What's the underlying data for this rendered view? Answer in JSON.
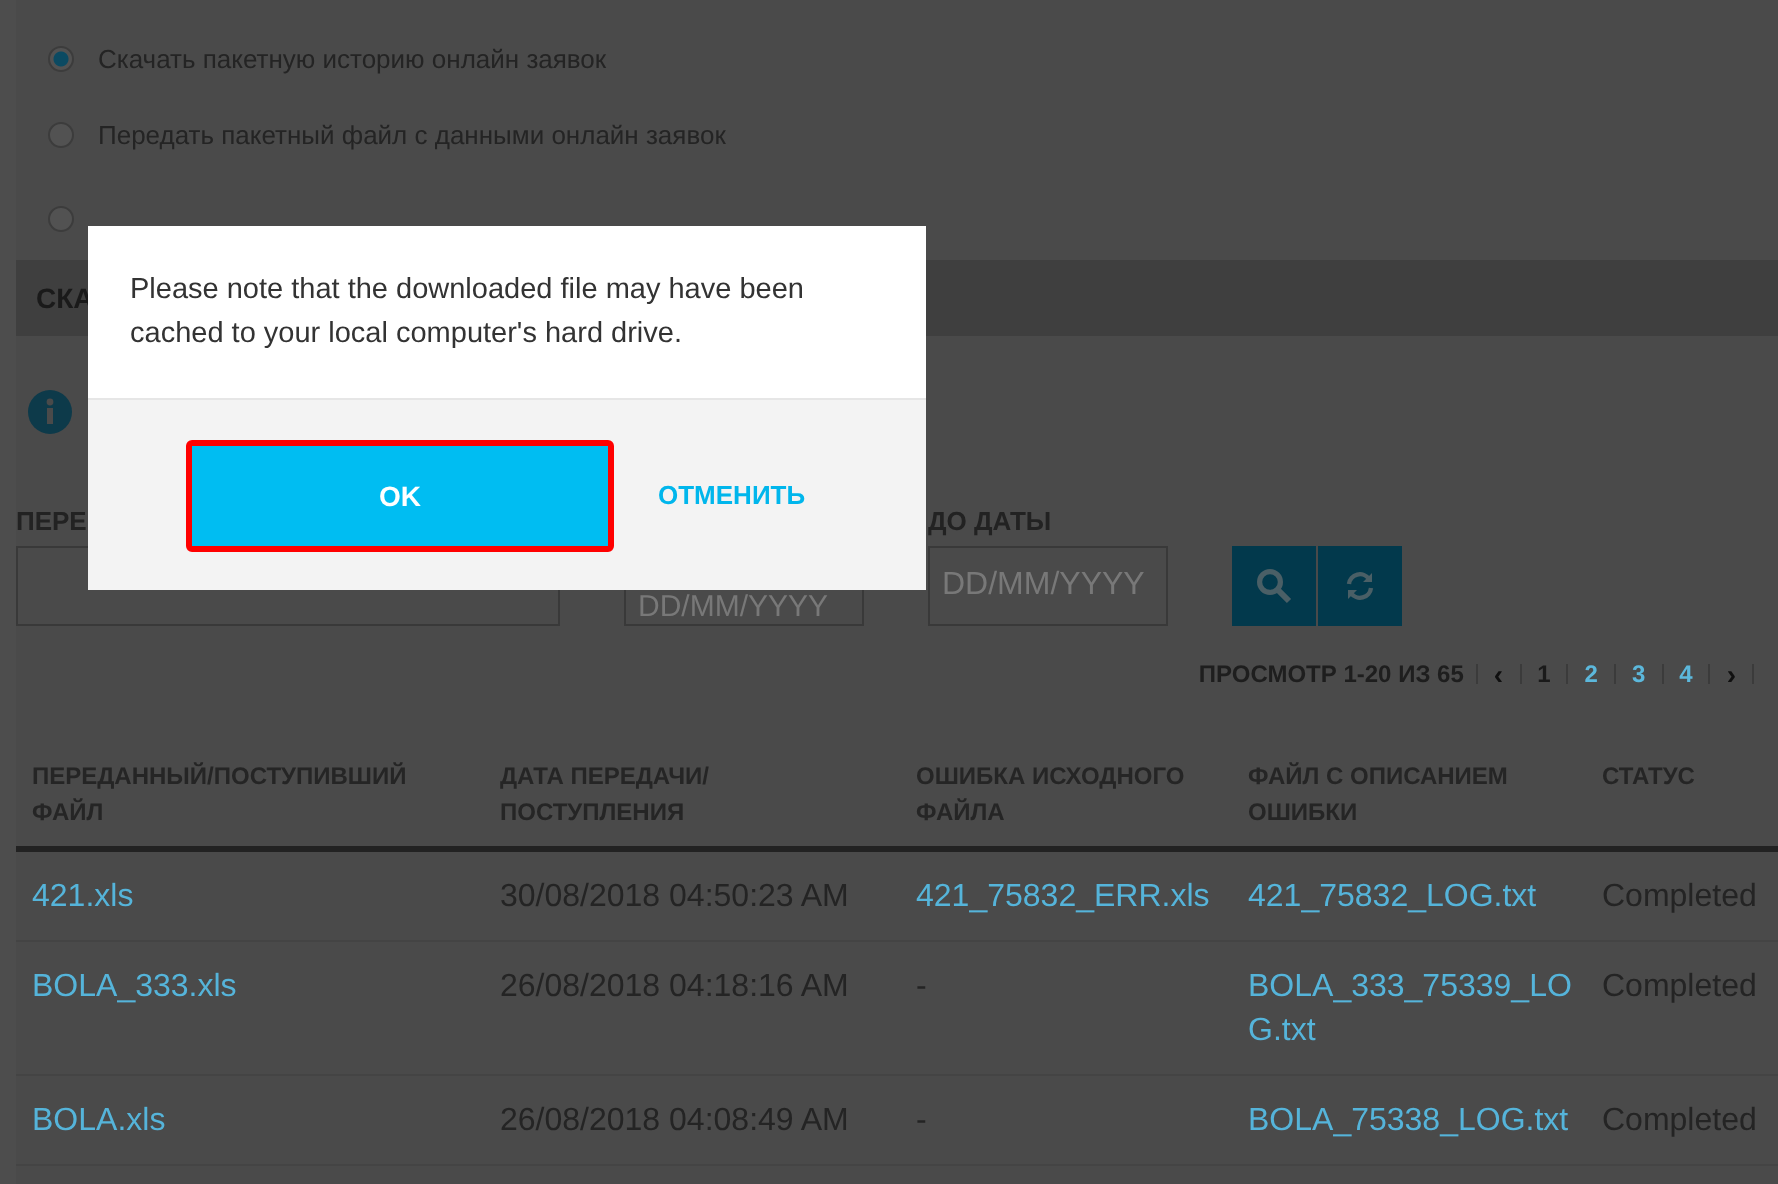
{
  "radio_options": [
    {
      "label": "Скачать пакетную историю онлайн заявок",
      "selected": true
    },
    {
      "label": "Передать пакетный файл с данными онлайн заявок",
      "selected": false
    },
    {
      "selected": false
    }
  ],
  "section_header": "СКА",
  "filters": [
    {
      "label": "ПЕРЕ"
    },
    {
      "placeholder": "DD/MM/YYYY"
    },
    {
      "label": "ДО ДАТЫ",
      "placeholder": "DD/MM/YYYY"
    }
  ],
  "pagination": {
    "summary": "ПРОСМОТР 1-20 ИЗ 65",
    "prev": "‹",
    "pages": [
      {
        "label": "1",
        "selected": true
      },
      {
        "label": "2",
        "selected": false
      },
      {
        "label": "3",
        "selected": false
      },
      {
        "label": "4",
        "selected": false
      }
    ],
    "next": "›"
  },
  "table": {
    "columns": [
      "ПЕРЕДАННЫЙ/ПОСТУПИВШИЙ ФАЙЛ",
      "ДАТА ПЕРЕДАЧИ/ПОСТУПЛЕНИЯ",
      "ОШИБКА ИСХОДНОГО ФАЙЛА",
      "ФАЙЛ С ОПИСАНИЕМ ОШИБКИ",
      "СТАТУС"
    ],
    "rows": [
      [
        {
          "text": "421.xls",
          "link": true
        },
        {
          "text": "30/08/2018 04:50:23 AM",
          "link": false
        },
        {
          "text": "421_75832_ERR.xls",
          "link": true
        },
        {
          "text": "421_75832_LOG.txt",
          "link": true
        },
        {
          "text": "Completed",
          "link": false
        }
      ],
      [
        {
          "text": "BOLA_333.xls",
          "link": true
        },
        {
          "text": "26/08/2018 04:18:16 AM",
          "link": false
        },
        {
          "text": "-",
          "link": false
        },
        {
          "text": "BOLA_333_75339_LOG.txt",
          "link": true
        },
        {
          "text": "Completed",
          "link": false
        }
      ],
      [
        {
          "text": "BOLA.xls",
          "link": true
        },
        {
          "text": "26/08/2018 04:08:49 AM",
          "link": false
        },
        {
          "text": "-",
          "link": false
        },
        {
          "text": "BOLA_75338_LOG.txt",
          "link": true
        },
        {
          "text": "Completed",
          "link": false
        }
      ]
    ]
  },
  "modal": {
    "message": "Please note that the downloaded file may have been cached to your local computer's hard drive.",
    "buttons": [
      {
        "label": "OK",
        "kind": "primary",
        "focused": true
      },
      {
        "label": "ОТМЕНИТЬ",
        "kind": "link",
        "focused": false
      }
    ]
  }
}
